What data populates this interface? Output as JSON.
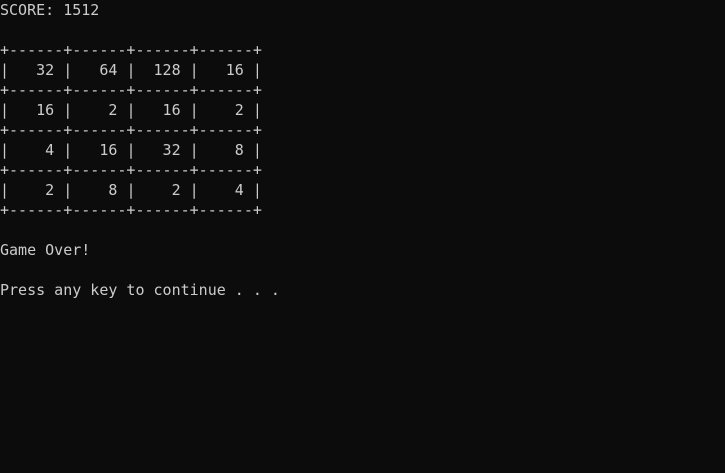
{
  "score_line": "SCORE: 1512",
  "board": {
    "cols": 4,
    "cell_width": 6,
    "rows": [
      [
        32,
        64,
        128,
        16
      ],
      [
        16,
        2,
        16,
        2
      ],
      [
        4,
        16,
        32,
        8
      ],
      [
        2,
        8,
        2,
        4
      ]
    ]
  },
  "game_over_text": "Game Over!",
  "continue_prompt": "Press any key to continue . . ."
}
